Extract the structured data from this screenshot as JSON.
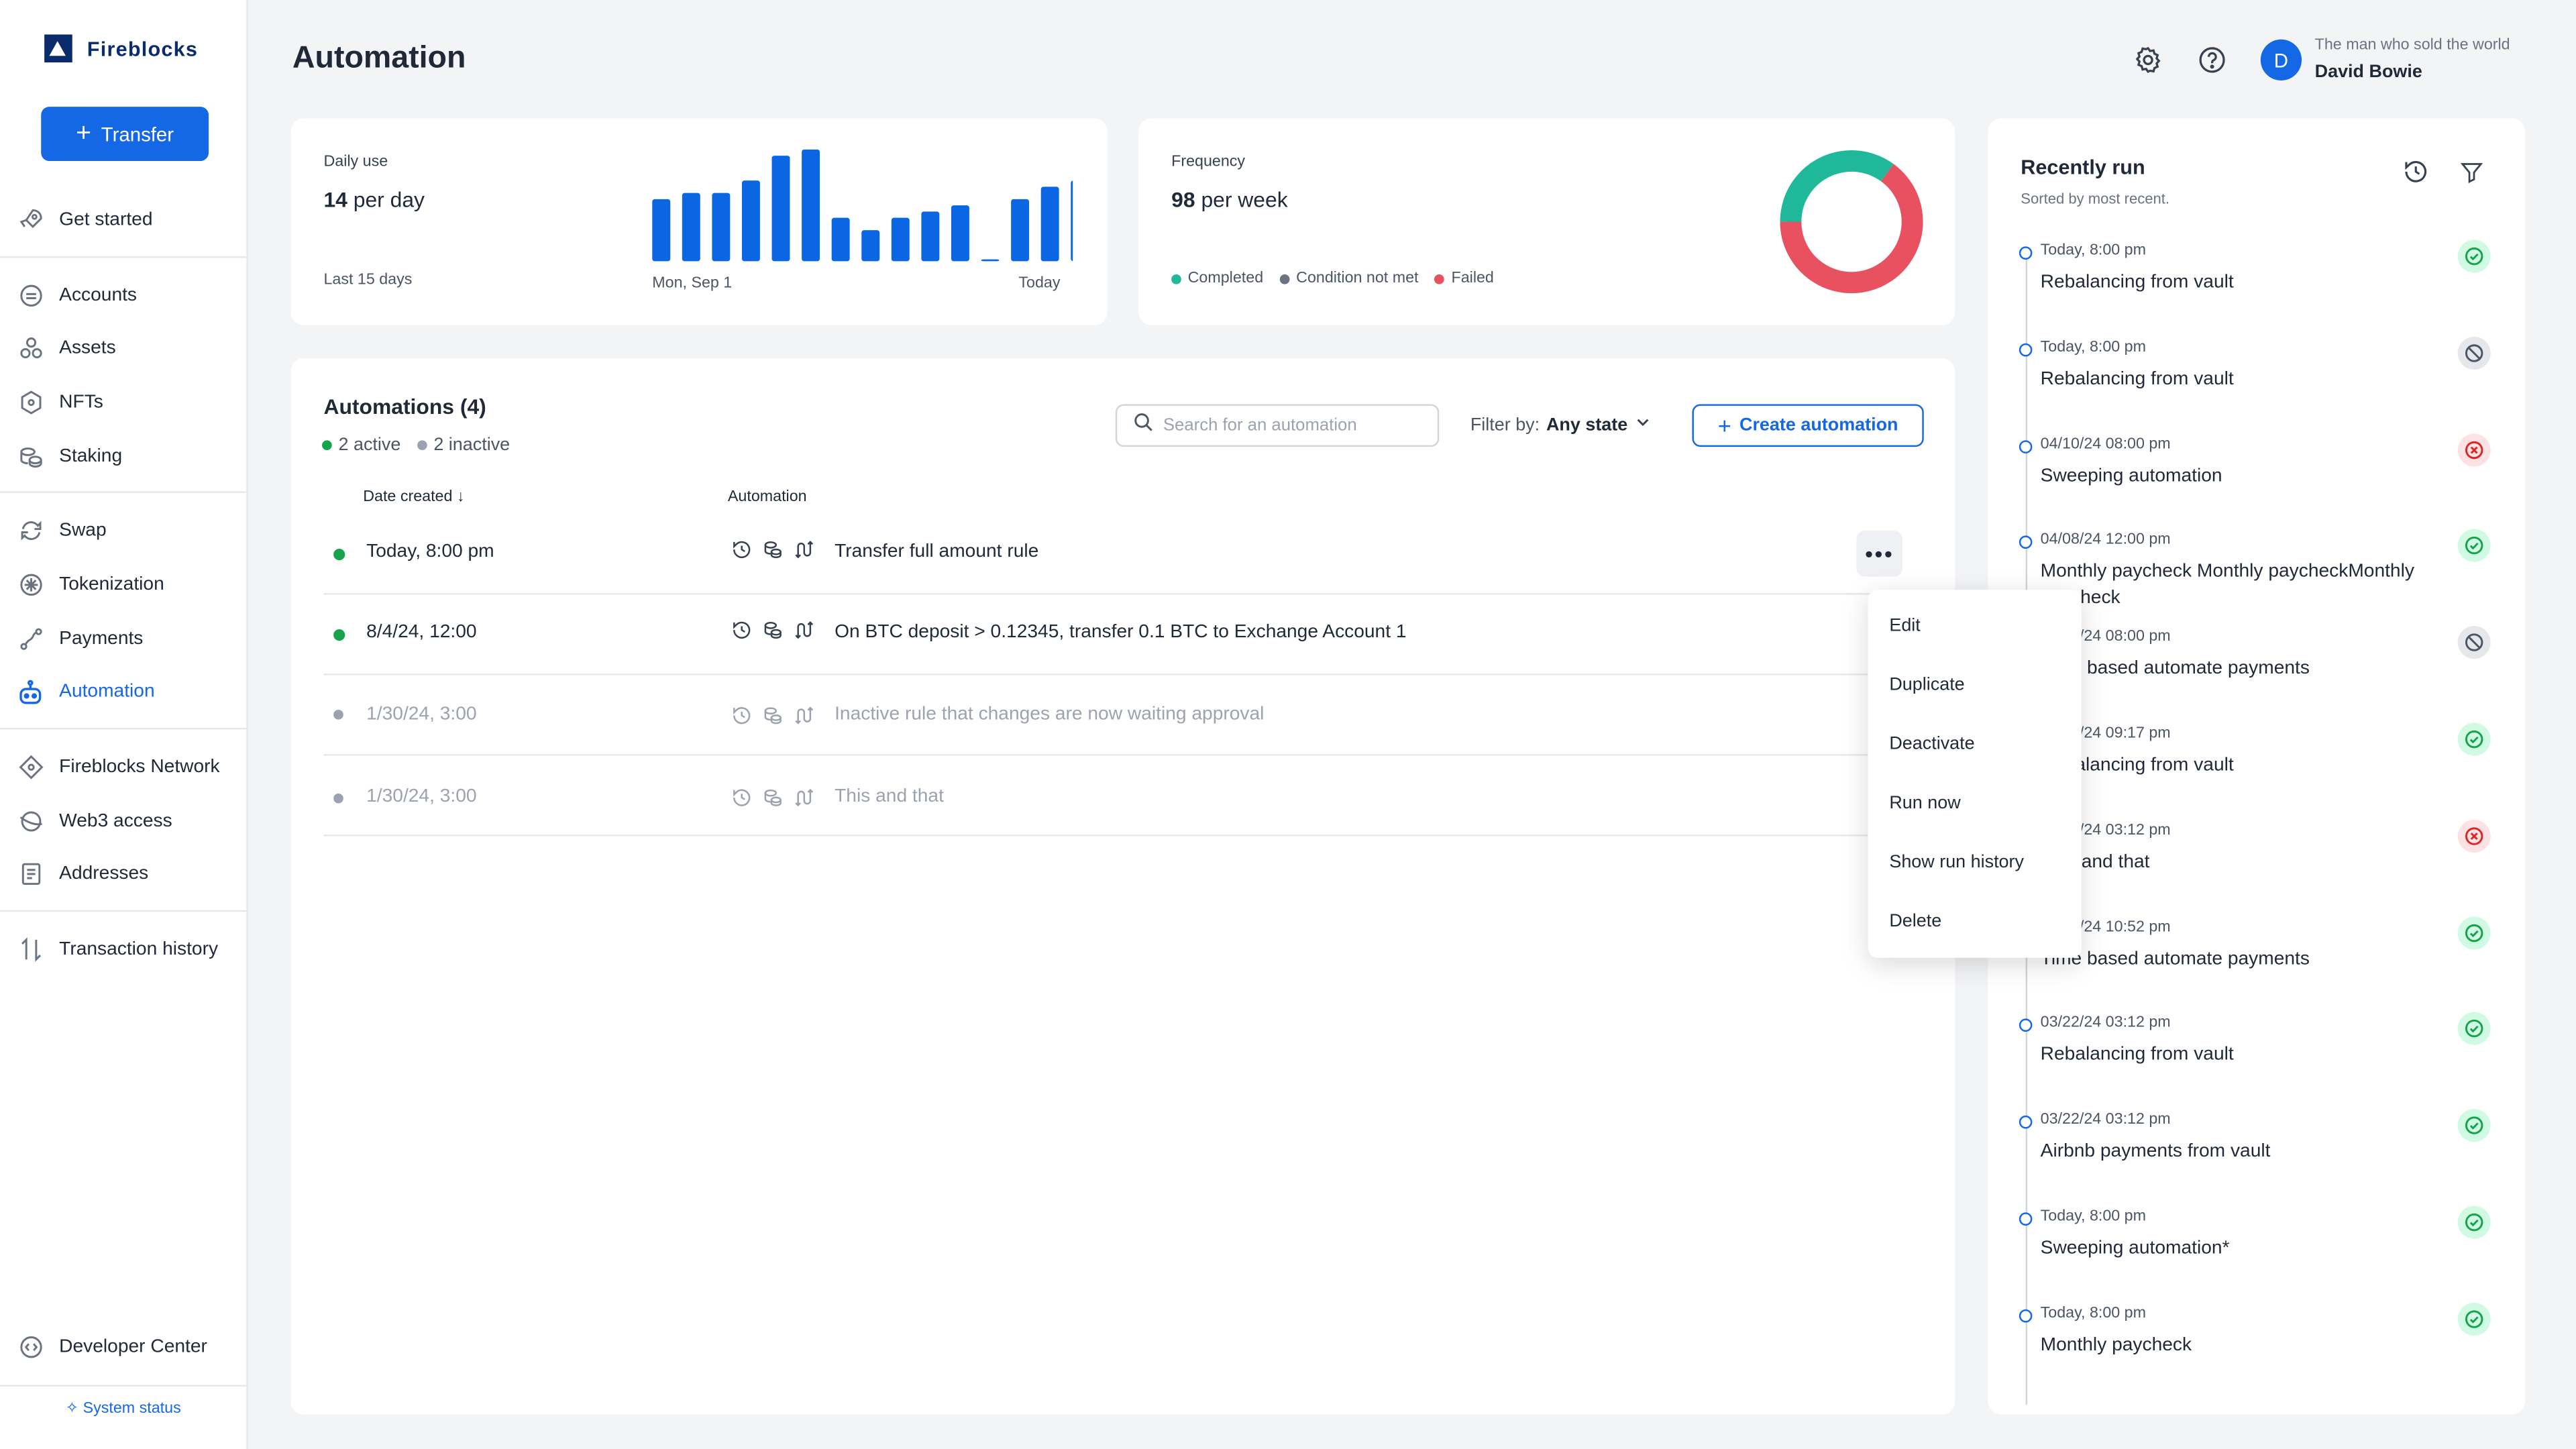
{
  "brand": {
    "name": "Fireblocks"
  },
  "sidebar": {
    "transfer_label": "Transfer",
    "items": [
      {
        "label": "Get started",
        "icon": "rocket-icon"
      },
      {
        "label": "Accounts",
        "icon": "wallet-icon"
      },
      {
        "label": "Assets",
        "icon": "assets-icon"
      },
      {
        "label": "NFTs",
        "icon": "nft-icon"
      },
      {
        "label": "Staking",
        "icon": "coins-icon"
      },
      {
        "label": "Swap",
        "icon": "swap-icon"
      },
      {
        "label": "Tokenization",
        "icon": "tokenization-icon"
      },
      {
        "label": "Payments",
        "icon": "payments-icon"
      },
      {
        "label": "Automation",
        "icon": "robot-icon",
        "active": true
      },
      {
        "label": "Fireblocks Network",
        "icon": "network-icon"
      },
      {
        "label": "Web3 access",
        "icon": "web3-icon"
      },
      {
        "label": "Addresses",
        "icon": "address-book-icon"
      },
      {
        "label": "Transaction history",
        "icon": "arrows-updown-icon"
      },
      {
        "label": "Developer Center",
        "icon": "code-icon"
      }
    ],
    "system_status": "System status"
  },
  "header": {
    "title": "Automation",
    "user_subtitle": "The man who sold the world",
    "user_name": "David Bowie",
    "avatar_initial": "D"
  },
  "daily_use": {
    "label": "Daily use",
    "value": "14",
    "unit": "per day",
    "footer": "Last 15 days",
    "axis_start": "Mon, Sep 1",
    "axis_end": "Today"
  },
  "chart_data": [
    {
      "type": "bar",
      "values": [
        10,
        11,
        11,
        13,
        17,
        18,
        7,
        5,
        7,
        8,
        9,
        0.3,
        10,
        12,
        13
      ],
      "ylim": [
        0,
        18
      ],
      "x_tick_labels": [
        "Mon, Sep 1",
        "Today"
      ],
      "color": "#0b66e4"
    },
    {
      "type": "pie",
      "donut": true,
      "values": [
        65,
        35
      ],
      "colors": [
        "#e8515f",
        "#1fb89a"
      ]
    }
  ],
  "frequency": {
    "label": "Frequency",
    "value": "98",
    "unit": "per week",
    "legend": [
      {
        "label": "Completed",
        "color": "#1fb89a"
      },
      {
        "label": "Condition not met",
        "color": "#6b7280"
      },
      {
        "label": "Failed",
        "color": "#e8515f"
      }
    ]
  },
  "automations": {
    "title": "Automations (4)",
    "active_label": "2 active",
    "inactive_label": "2 inactive",
    "search_placeholder": "Search for an automation",
    "filter_label": "Filter by:",
    "filter_value": "Any state",
    "create_label": "Create automation",
    "col_date": "Date created",
    "col_automation": "Automation",
    "rows": [
      {
        "date": "Today, 8:00 pm",
        "name": "Transfer full amount rule",
        "active": true
      },
      {
        "date": "8/4/24, 12:00",
        "name": "On BTC deposit > 0.12345, transfer 0.1 BTC to Exchange Account 1",
        "active": true
      },
      {
        "date": "1/30/24, 3:00",
        "name": "Inactive rule that changes are now waiting approval",
        "active": false
      },
      {
        "date": "1/30/24, 3:00",
        "name": "This and that",
        "active": false
      }
    ]
  },
  "menu": {
    "items": [
      "Edit",
      "Duplicate",
      "Deactivate",
      "Run now",
      "Show run history",
      "Delete"
    ]
  },
  "recently_run": {
    "title": "Recently run",
    "subtitle": "Sorted by most recent.",
    "items": [
      {
        "time": "Today, 8:00 pm",
        "name": "Rebalancing from vault",
        "status": "completed"
      },
      {
        "time": "Today, 8:00 pm",
        "name": "Rebalancing from vault",
        "status": "condition-not-met"
      },
      {
        "time": "04/10/24 08:00 pm",
        "name": "Sweeping automation",
        "status": "failed"
      },
      {
        "time": "04/08/24 12:00 pm",
        "name": "Monthly paycheck Monthly paycheckMonthly paycheck",
        "status": "completed"
      },
      {
        "time": "04/04/24 08:00 pm",
        "name": "Time based automate payments",
        "status": "condition-not-met"
      },
      {
        "time": "03/28/24 09:17 pm",
        "name": "Rebalancing from vault",
        "status": "completed"
      },
      {
        "time": "03/22/24 03:12 pm",
        "name": "This and that",
        "status": "failed"
      },
      {
        "time": "03/21/24 10:52 pm",
        "name": "Time based automate payments",
        "status": "completed"
      },
      {
        "time": "03/22/24 03:12 pm",
        "name": "Rebalancing from vault",
        "status": "completed"
      },
      {
        "time": "03/22/24 03:12 pm",
        "name": "Airbnb payments from vault",
        "status": "completed"
      },
      {
        "time": "Today, 8:00 pm",
        "name": "Sweeping automation*",
        "status": "completed"
      },
      {
        "time": "Today, 8:00 pm",
        "name": "Monthly paycheck",
        "status": "completed"
      }
    ]
  }
}
